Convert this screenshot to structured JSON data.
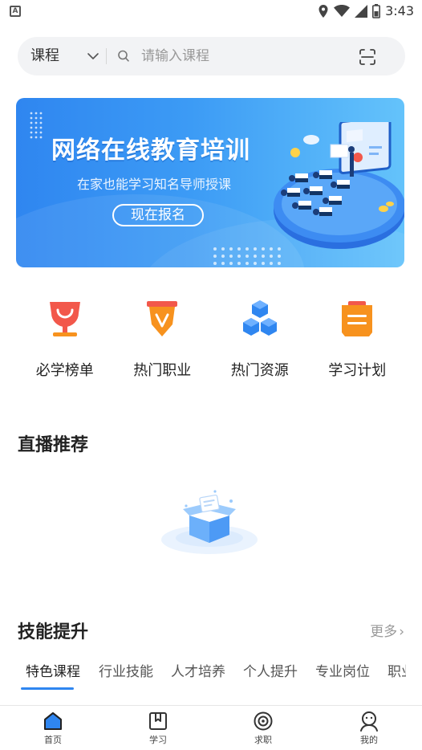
{
  "status_bar": {
    "time": "3:43",
    "left_badge": "A",
    "icons": [
      "location-icon",
      "wifi-icon",
      "signal-icon",
      "battery-icon"
    ]
  },
  "search": {
    "category": "课程",
    "placeholder": "请输入课程",
    "icons": [
      "chevron-down-icon",
      "search-icon",
      "scan-icon"
    ]
  },
  "banner": {
    "title": "网络在线教育培训",
    "subtitle": "在家也能学习知名导师授课",
    "button": "现在报名"
  },
  "quick_entries": [
    {
      "label": "必学榜单",
      "icon": "trophy-icon",
      "color": "#f2584b"
    },
    {
      "label": "热门职业",
      "icon": "badge-icon",
      "color": "#f7921e"
    },
    {
      "label": "热门资源",
      "icon": "cubes-icon",
      "color": "#2f86f0"
    },
    {
      "label": "学习计划",
      "icon": "plan-icon",
      "color": "#f7921e"
    }
  ],
  "live": {
    "title": "直播推荐",
    "empty_icon": "empty-box-icon"
  },
  "skills": {
    "title": "技能提升",
    "more": "更多",
    "tabs": [
      "特色课程",
      "行业技能",
      "人才培养",
      "个人提升",
      "专业岗位",
      "职业"
    ],
    "active_tab": 0
  },
  "bottom_nav": [
    {
      "label": "首页",
      "icon": "home-icon",
      "active": true
    },
    {
      "label": "学习",
      "icon": "book-icon",
      "active": false
    },
    {
      "label": "求职",
      "icon": "target-icon",
      "active": false
    },
    {
      "label": "我的",
      "icon": "profile-icon",
      "active": false
    }
  ],
  "colors": {
    "accent": "#2f86f0",
    "search_bg": "#f2f3f5",
    "text": "#222222",
    "muted": "#999999"
  }
}
